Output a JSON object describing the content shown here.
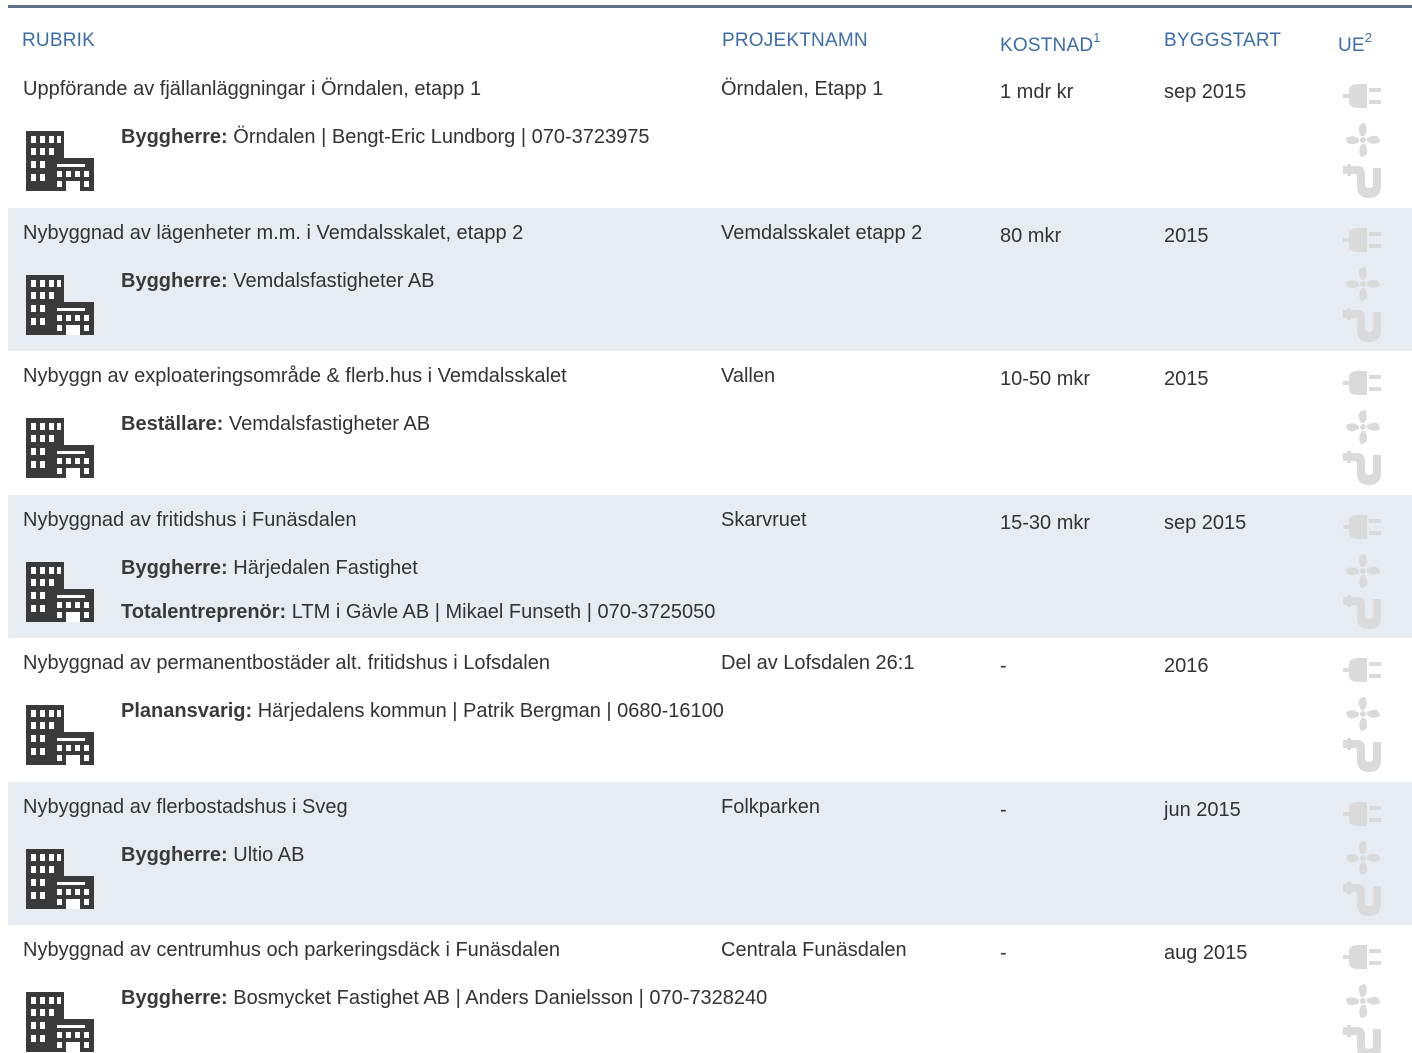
{
  "header": {
    "rubrik": "RUBRIK",
    "projektnamn": "PROJEKTNAMN",
    "kostnad": "KOSTNAD",
    "kostnad_sup": "1",
    "byggstart": "BYGGSTART",
    "ue": "UE",
    "ue_sup": "2"
  },
  "rows": [
    {
      "rubrik": "Uppförande av fjällanläggningar i Örndalen, etapp 1",
      "projektnamn": "Örndalen, Etapp 1",
      "kostnad": "1 mdr kr",
      "byggstart": "sep 2015",
      "contacts": [
        {
          "role": "Byggherre:",
          "text": "Örndalen | Bengt-Eric Lundborg | 070-3723975"
        }
      ]
    },
    {
      "rubrik": "Nybyggnad av lägenheter m.m. i Vemdalsskalet, etapp 2",
      "projektnamn": "Vemdalsskalet etapp 2",
      "kostnad": "80 mkr",
      "byggstart": "2015",
      "contacts": [
        {
          "role": "Byggherre:",
          "text": "Vemdalsfastigheter AB"
        }
      ]
    },
    {
      "rubrik": "Nybyggn av exploateringsområde & flerb.hus i Vemdalsskalet",
      "projektnamn": "Vallen",
      "kostnad": "10-50 mkr",
      "byggstart": "2015",
      "contacts": [
        {
          "role": "Beställare:",
          "text": "Vemdalsfastigheter AB"
        }
      ]
    },
    {
      "rubrik": "Nybyggnad av fritidshus i Funäsdalen",
      "projektnamn": "Skarvruet",
      "kostnad": "15-30 mkr",
      "byggstart": "sep 2015",
      "contacts": [
        {
          "role": "Byggherre:",
          "text": "Härjedalen Fastighet"
        },
        {
          "role": "Totalentreprenör:",
          "text": "LTM i Gävle AB | Mikael Funseth | 070-3725050"
        }
      ]
    },
    {
      "rubrik": "Nybyggnad av permanentbostäder alt. fritidshus i Lofsdalen",
      "projektnamn": "Del av Lofsdalen 26:1",
      "kostnad": "-",
      "byggstart": "2016",
      "contacts": [
        {
          "role": "Planansvarig:",
          "text": "Härjedalens kommun | Patrik Bergman | 0680-16100"
        }
      ]
    },
    {
      "rubrik": "Nybyggnad av flerbostadshus i Sveg",
      "projektnamn": "Folkparken",
      "kostnad": "-",
      "byggstart": "jun 2015",
      "contacts": [
        {
          "role": "Byggherre:",
          "text": "Ultio AB"
        }
      ]
    },
    {
      "rubrik": "Nybyggnad av centrumhus och parkeringsdäck i Funäsdalen",
      "projektnamn": "Centrala Funäsdalen",
      "kostnad": "-",
      "byggstart": "aug 2015",
      "contacts": [
        {
          "role": "Byggherre:",
          "text": "Bosmycket Fastighet AB | Anders Danielsson | 070-7328240"
        }
      ]
    }
  ],
  "icons": {
    "building": "building-icon",
    "ue": [
      "electric-plug-icon",
      "ventilation-fan-icon",
      "plumbing-pipe-icon"
    ]
  },
  "colors": {
    "header_text": "#3d6da8",
    "top_rule": "#5f7189",
    "row_shade": "#e7ecf2",
    "icon_dark": "#3a3a3a",
    "ue_icon": "#d9d9d9"
  }
}
